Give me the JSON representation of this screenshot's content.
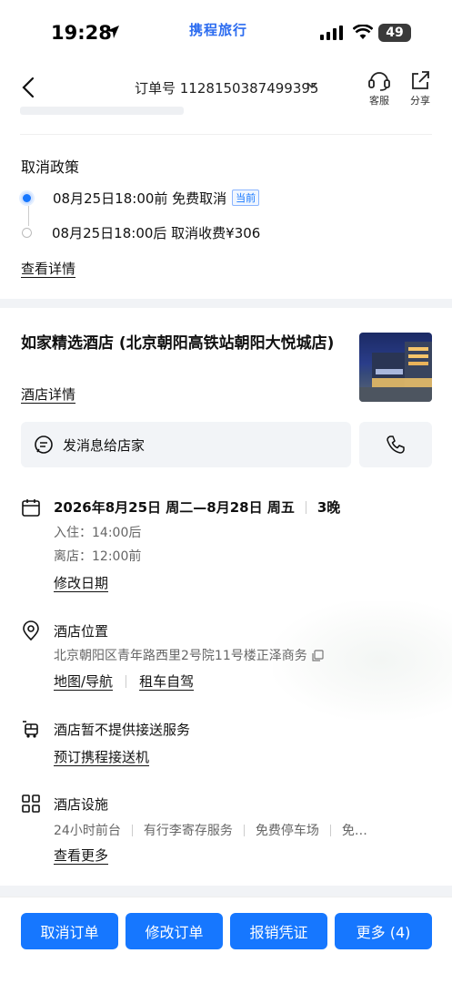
{
  "status_bar": {
    "time": "19:28",
    "app_logo": "携程旅行",
    "battery": "49"
  },
  "nav": {
    "title": "订单号 1128150387499395",
    "service_label": "客服",
    "share_label": "分享"
  },
  "cancel_policy": {
    "title": "取消政策",
    "items": [
      {
        "text": "08月25日18:00前 免费取消",
        "badge": "当前",
        "active": true
      },
      {
        "text": "08月25日18:00后 取消收费¥306",
        "active": false
      }
    ],
    "details_link": "查看详情"
  },
  "hotel": {
    "name": "如家精选酒店 (北京朝阳高铁站朝阳大悦城店)",
    "details_link": "酒店详情",
    "message_button": "发消息给店家"
  },
  "stay": {
    "dates": "2026年8月25日 周二—8月28日 周五",
    "nights": "3晚",
    "checkin": "入住：14:00后",
    "checkout": "离店：12:00前",
    "modify_link": "修改日期"
  },
  "location": {
    "title": "酒店位置",
    "address": "北京朝阳区青年路西里2号院11号楼正泽商务",
    "map_link": "地图/导航",
    "car_link": "租车自驾"
  },
  "shuttle": {
    "title": "酒店暂不提供接送服务",
    "book_link": "预订携程接送机"
  },
  "facilities": {
    "title": "酒店设施",
    "items": [
      "24小时前台",
      "有行李寄存服务",
      "免费停车场",
      "免…"
    ],
    "more_link": "查看更多"
  },
  "actions": {
    "cancel": "取消订单",
    "modify": "修改订单",
    "invoice": "报销凭证",
    "more": "更多 (4)"
  },
  "colors": {
    "accent": "#1677ff",
    "bg_gray": "#f2f4f7"
  }
}
